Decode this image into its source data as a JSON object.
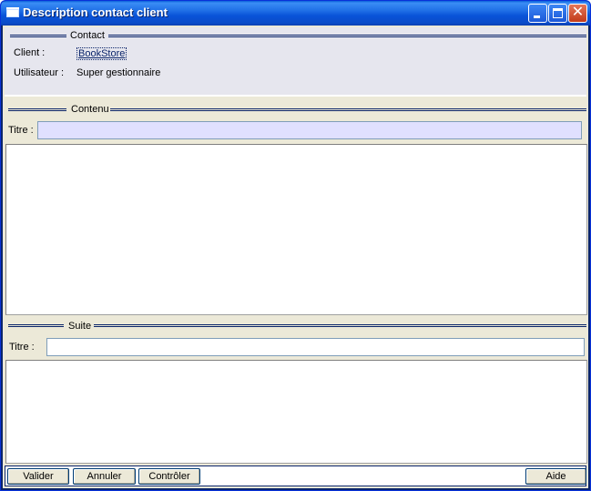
{
  "window": {
    "title": "Description contact client"
  },
  "contact": {
    "section_label": "Contact",
    "client_label": "Client :",
    "client_value": "BookStore",
    "user_label": "Utilisateur :",
    "user_value": "Super gestionnaire"
  },
  "contenu": {
    "section_label": "Contenu",
    "title_label": "Titre :",
    "title_value": "",
    "body_value": ""
  },
  "suite": {
    "section_label": "Suite",
    "title_label": "Titre :",
    "title_value": "",
    "body_value": ""
  },
  "buttons": {
    "validate": "Valider",
    "cancel": "Annuler",
    "check": "Contrôler",
    "help": "Aide"
  }
}
